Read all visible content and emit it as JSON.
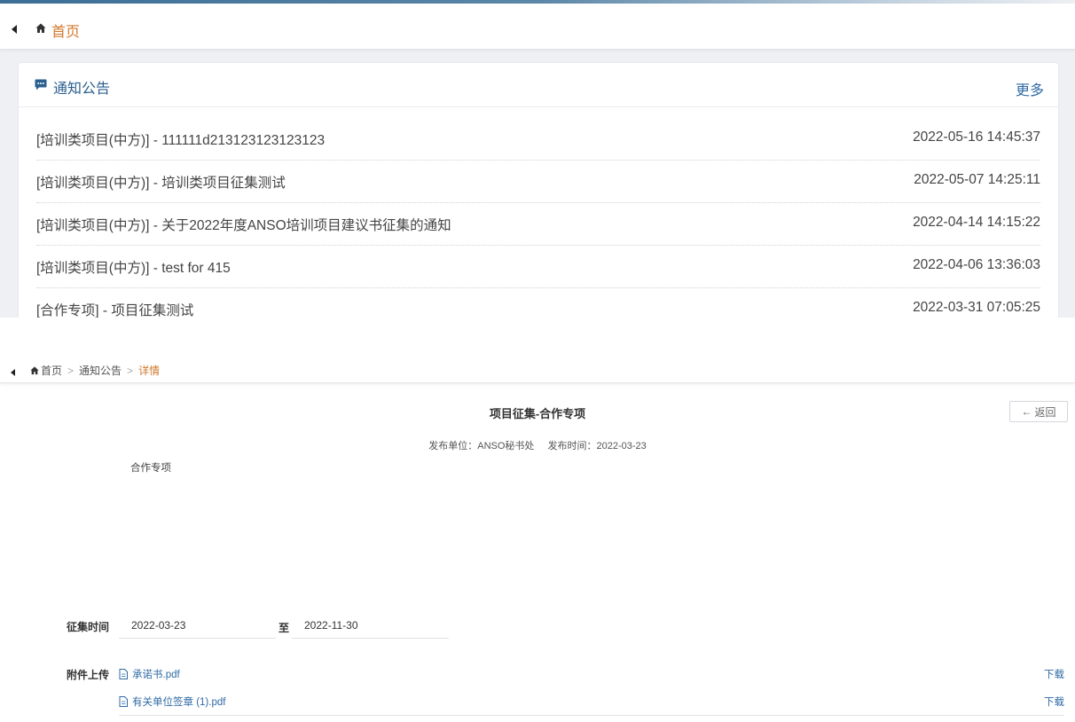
{
  "top": {
    "breadcrumb_home": "首页",
    "notice_card": {
      "title": "通知公告",
      "more_label": "更多",
      "items": [
        {
          "title": "[培训类项目(中方)] - 111111d213123123123123",
          "time": "2022-05-16 14:45:37"
        },
        {
          "title": "[培训类项目(中方)] - 培训类项目征集测试",
          "time": "2022-05-07 14:25:11"
        },
        {
          "title": "[培训类项目(中方)] - 关于2022年度ANSO培训项目建议书征集的通知",
          "time": "2022-04-14 14:15:22"
        },
        {
          "title": "[培训类项目(中方)] - test for 415",
          "time": "2022-04-06 13:36:03"
        },
        {
          "title": "[合作专项] - 项目征集测试",
          "time": "2022-03-31 07:05:25"
        }
      ]
    }
  },
  "detail": {
    "breadcrumb": {
      "home": "首页",
      "section": "通知公告",
      "current": "详情",
      "separator": ">"
    },
    "title": "项目征集-合作专项",
    "back_label": "返回",
    "back_arrow": "←",
    "publisher": "发布单位：ANSO秘书处",
    "publish_time": "发布时间：2022-03-23",
    "body": "合作专项",
    "collection_period": {
      "label": "征集时间",
      "start": "2022-03-23",
      "separator": "至",
      "end": "2022-11-30"
    },
    "attachments": {
      "label": "附件上传",
      "download_label": "下载",
      "files": [
        {
          "name": "承诺书.pdf"
        },
        {
          "name": "有关单位签章 (1).pdf"
        }
      ]
    }
  },
  "colors": {
    "accent_orange": "#d2782c",
    "link_blue": "#2f6aa5",
    "title_blue": "#2a5f8f"
  }
}
